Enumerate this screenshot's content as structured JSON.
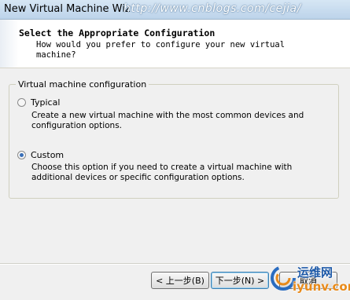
{
  "window": {
    "title": "New Virtual Machine Wiz",
    "watermark": "http://www.cnblogs.com/cejia/"
  },
  "header": {
    "title": "Select the Appropriate Configuration",
    "subtitle": "How would you prefer to configure your new virtual machine?"
  },
  "group": {
    "label": "Virtual machine configuration",
    "options": [
      {
        "label": "Typical",
        "description": "Create a new virtual machine with the most common devices and configuration options.",
        "selected": false
      },
      {
        "label": "Custom",
        "description": "Choose this option if you need to create a virtual machine with additional devices or specific configuration options.",
        "selected": true
      }
    ]
  },
  "buttons": {
    "back": "< 上一步(B)",
    "next": "下一步(N) >",
    "cancel": "取消"
  },
  "logo": {
    "text_cn": "运维网",
    "text_en": "iyunv.com"
  },
  "colors": {
    "accent": "#3a6fb8",
    "logo_blue": "#1e5aa8",
    "logo_orange": "#e88a1a"
  }
}
